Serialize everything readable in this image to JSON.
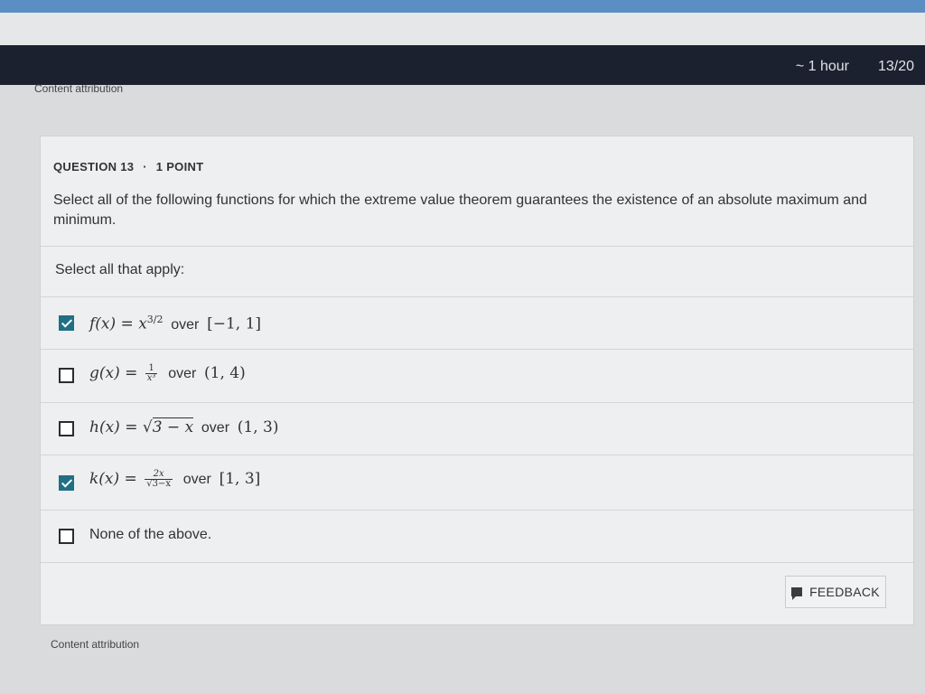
{
  "header": {
    "timer": "~ 1 hour",
    "progress": "13/20"
  },
  "attribution_top": "Content attribution",
  "question": {
    "header_number": "QUESTION 13",
    "header_separator": "·",
    "header_points": "1 POINT",
    "text": "Select all of the following functions for which the extreme value theorem guarantees the existence of an absolute maximum and minimum.",
    "instruction": "Select all that apply:"
  },
  "options": [
    {
      "checked": true,
      "parts": {
        "lhs": "f(x) = x",
        "sup": "3/2",
        "over": "over",
        "interval": "[−1, 1]"
      }
    },
    {
      "checked": false,
      "parts": {
        "lhs": "g(x) = ",
        "num": "1",
        "den": "x³",
        "over": "over",
        "interval": "(1, 4)"
      }
    },
    {
      "checked": false,
      "parts": {
        "lhs": "h(x) = ",
        "radical": "√",
        "radicand": "3 − x",
        "over": "over",
        "interval": "(1, 3)"
      }
    },
    {
      "checked": true,
      "parts": {
        "lhs": "k(x) = ",
        "num": "2x",
        "den": "√3−x",
        "over": "over",
        "interval": "[1, 3]"
      }
    },
    {
      "checked": false,
      "parts": {
        "text": "None of the above."
      }
    }
  ],
  "feedback_label": "FEEDBACK",
  "attribution_bottom": "Content attribution",
  "icons": {
    "checkbox": "checkbox-icon",
    "feedback": "comment-icon"
  },
  "colors": {
    "header_bg": "#1c2130",
    "checked": "#1f6f86",
    "top_strip": "#5b8fc3"
  }
}
